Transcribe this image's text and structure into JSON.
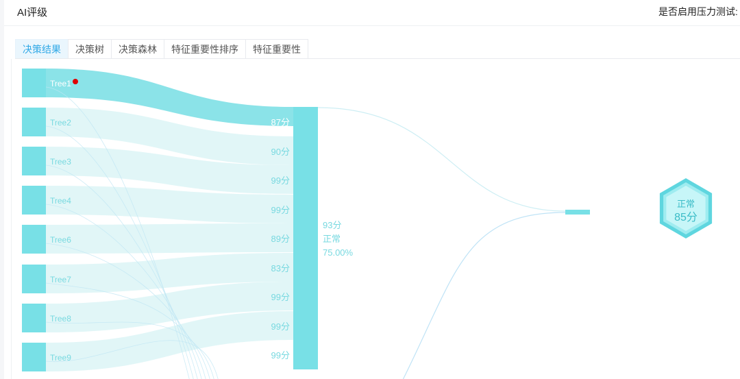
{
  "header": {
    "title": "AI评级",
    "stress_test_label": "是否启用压力测试:"
  },
  "tabs": [
    {
      "label": "决策结果",
      "active": true
    },
    {
      "label": "决策树",
      "active": false
    },
    {
      "label": "决策森林",
      "active": false
    },
    {
      "label": "特征重要性排序",
      "active": false
    },
    {
      "label": "特征重要性",
      "active": false
    }
  ],
  "chart_data": {
    "type": "sankey",
    "sources": [
      {
        "name": "Tree1",
        "highlighted": true
      },
      {
        "name": "Tree2"
      },
      {
        "name": "Tree3"
      },
      {
        "name": "Tree4"
      },
      {
        "name": "Tree6"
      },
      {
        "name": "Tree7"
      },
      {
        "name": "Tree8"
      },
      {
        "name": "Tree9"
      }
    ],
    "score_labels": [
      "87分",
      "90分",
      "99分",
      "99分",
      "89分",
      "83分",
      "99分",
      "99分",
      "99分"
    ],
    "aggregate": {
      "score": "93分",
      "status": "正常",
      "percent": "75.00%"
    },
    "result": {
      "status": "正常",
      "score": "85分"
    },
    "colors": {
      "node": "#78e0e6",
      "link_main": "#7ee0e6",
      "link_light": "#dff6f7",
      "link_line": "#bfe6f4",
      "label": "#78d9e0",
      "marker": "#e00000"
    }
  }
}
